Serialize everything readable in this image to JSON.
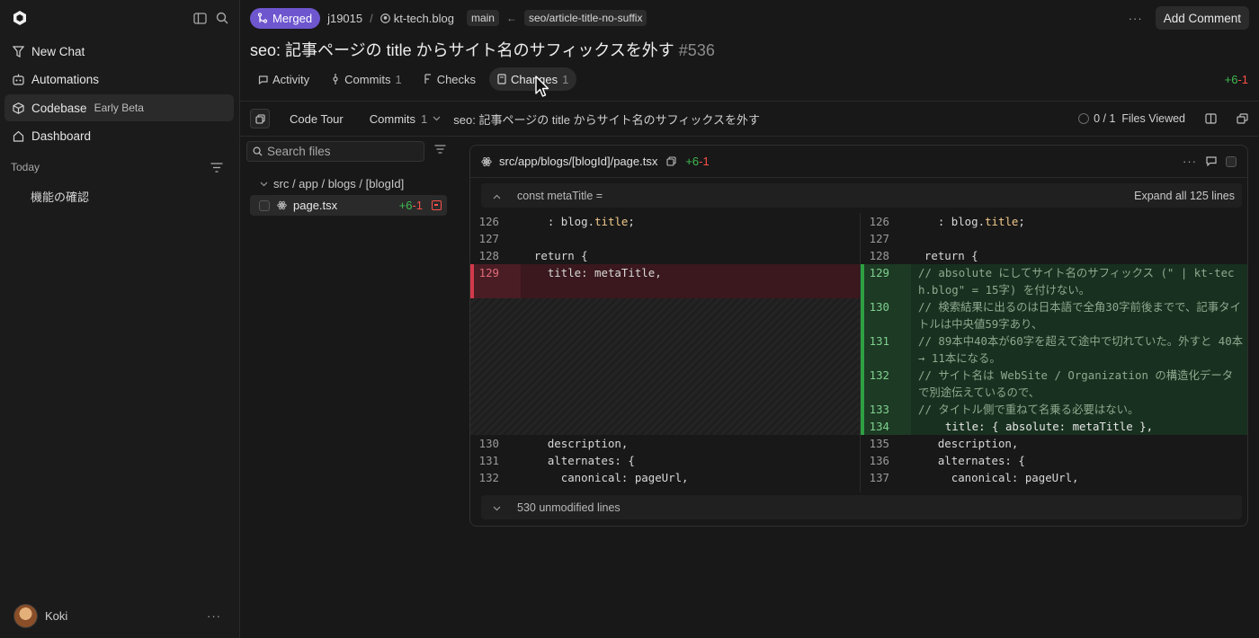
{
  "sidebar": {
    "nav": [
      {
        "label": "New Chat",
        "icon": "new-chat-icon"
      },
      {
        "label": "Automations",
        "icon": "automations-icon"
      },
      {
        "label": "Codebase",
        "badge": "Early Beta",
        "icon": "codebase-icon",
        "active": true
      },
      {
        "label": "Dashboard",
        "icon": "dashboard-icon"
      }
    ],
    "section_label": "Today",
    "history": [
      "機能の確認"
    ],
    "user": {
      "name": "Koki"
    }
  },
  "header": {
    "status": "Merged",
    "owner": "j19015",
    "repo": "kt-tech.blog",
    "base_branch": "main",
    "head_branch": "seo/article-title-no-suffix",
    "add_comment": "Add Comment",
    "pr_title": "seo: 記事ページの title からサイト名のサフィックスを外す",
    "pr_number": "#536"
  },
  "tabs": [
    {
      "label": "Activity",
      "count": ""
    },
    {
      "label": "Commits",
      "count": "1"
    },
    {
      "label": "Checks",
      "count": ""
    },
    {
      "label": "Changes",
      "count": "1",
      "active": true
    }
  ],
  "totals": {
    "additions": "+6",
    "deletions": "-1"
  },
  "toolbar": {
    "code_tour": "Code Tour",
    "commits_label": "Commits",
    "commits_count": "1",
    "commit_title": "seo: 記事ページの title からサイト名のサフィックスを外す",
    "files_viewed": "0 / 1  Files Viewed"
  },
  "files_panel": {
    "search_placeholder": "Search files",
    "dir": "src / app / blogs / [blogId]",
    "file": {
      "name": "page.tsx",
      "additions": "+6",
      "deletions": "-1"
    }
  },
  "diff": {
    "path": "src/app/blogs/[blogId]/page.tsx",
    "additions": "+6",
    "deletions": "-1",
    "context_label": "const metaTitle =",
    "expand_label": "Expand all 125 lines",
    "footer_label": "530 unmodified lines",
    "left": [
      {
        "no": "126",
        "text": "    : blog.title;"
      },
      {
        "no": "127",
        "text": ""
      },
      {
        "no": "128",
        "text": "  return {"
      },
      {
        "no": "129",
        "text": "    title: metaTitle,"
      },
      {
        "no": "130",
        "text": "    description,"
      },
      {
        "no": "131",
        "text": "    alternates: {"
      },
      {
        "no": "132",
        "text": "      canonical: pageUrl,"
      }
    ],
    "right_context_top": [
      {
        "no": "126",
        "text": "    : blog.title;"
      },
      {
        "no": "127",
        "text": ""
      },
      {
        "no": "128",
        "text": "  return {"
      }
    ],
    "right_added": [
      {
        "no": "129",
        "text": "    // absolute にしてサイト名のサフィックス (\" | kt-tech.blog\" = 15字) を付けない。"
      },
      {
        "no": "130",
        "text": "    // 検索結果に出るのは日本語で全角30字前後までで、記事タイトルは中央値59字あり、"
      },
      {
        "no": "131",
        "text": "    // 89本中40本が60字を超えて途中で切れていた。外すと 40本 → 11本になる。"
      },
      {
        "no": "132",
        "text": "    // サイト名は WebSite / Organization の構造化データで別途伝えているので、"
      },
      {
        "no": "133",
        "text": "    // タイトル側で重ねて名乗る必要はない。"
      },
      {
        "no": "134",
        "text": "    title: { absolute: metaTitle },"
      }
    ],
    "right_context_bottom": [
      {
        "no": "135",
        "text": "    description,"
      },
      {
        "no": "136",
        "text": "    alternates: {"
      },
      {
        "no": "137",
        "text": "      canonical: pageUrl,"
      }
    ]
  },
  "colors": {
    "merged": "#6e56cf",
    "additions": "#3fb950",
    "deletions": "#f85149"
  }
}
